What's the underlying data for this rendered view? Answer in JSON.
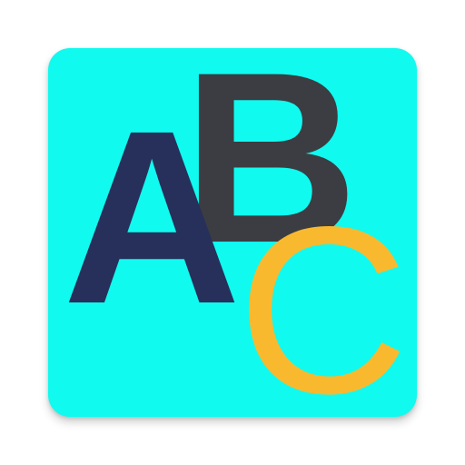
{
  "icon": {
    "background_color": "#10FAF0",
    "letters": [
      {
        "char": "A",
        "color": "#27305A"
      },
      {
        "char": "B",
        "color": "#3B3D42"
      },
      {
        "char": "C",
        "color": "#F9B92F"
      }
    ]
  }
}
